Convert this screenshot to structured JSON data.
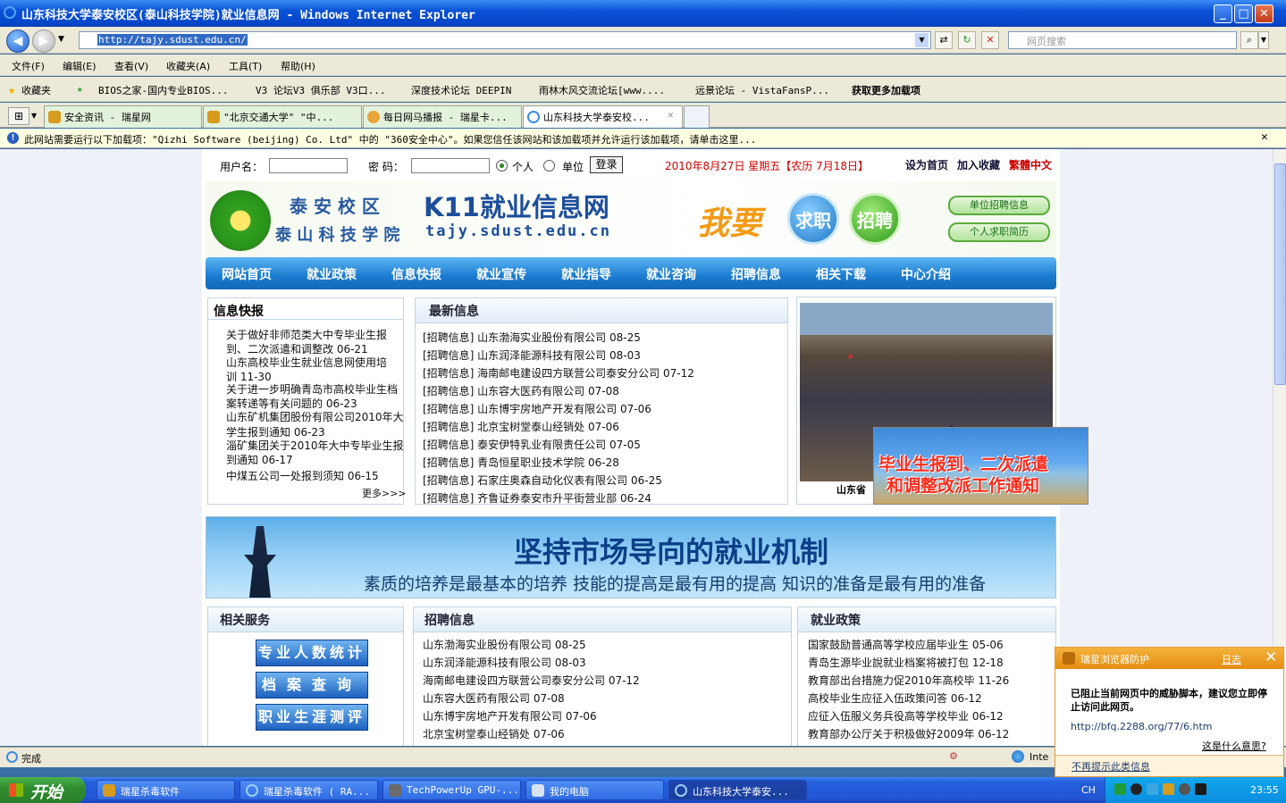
{
  "window": {
    "title": "山东科技大学泰安校区(泰山科技学院)就业信息网 - Windows Internet Explorer"
  },
  "address": {
    "url": "http://tajy.sdust.edu.cn/",
    "search_placeholder": "网页搜索"
  },
  "menu": [
    "文件(F)",
    "编辑(E)",
    "查看(V)",
    "收藏夹(A)",
    "工具(T)",
    "帮助(H)"
  ],
  "favorites": {
    "label": "收藏夹",
    "items": [
      "BIOS之家-国内专业BIOS...",
      "V3 论坛V3 俱乐部 V3口...",
      "深度技术论坛 DEEPIN",
      "雨林木风交流论坛[www....",
      "远景论坛 - VistaFansP...",
      "获取更多加载项"
    ]
  },
  "tabs": [
    "安全资讯 - 瑞星网",
    "\"北京交通大学\" \"中...",
    "每日网马播报 - 瑞星卡...",
    "山东科技大学泰安校..."
  ],
  "infobar": "此网站需要运行以下加载项：\"Qizhi Software (beijing) Co. Ltd\" 中的 \"360安全中心\"。如果您信任该网站和该加载项并允许运行该加载项，请单击这里...",
  "login": {
    "user_label": "用户名：",
    "pwd_label": "密 码：",
    "radio1": "个人",
    "radio2": "单位",
    "submit": "登录",
    "date": "2010年8月27日 星期五【农历 7月18日】",
    "set_home": "设为首页",
    "add_fav": "加入收藏",
    "trad": "繁體中文"
  },
  "banner": {
    "campus": "泰 安 校 区",
    "college": "泰 山 科 技 学 院",
    "title": "K11就业信息网",
    "domain": "tajy.sdust.edu.cn",
    "want": "我要",
    "job": "求职",
    "recruit": "招聘",
    "btn1": "单位招聘信息",
    "btn2": "个人求职简历"
  },
  "nav": [
    "网站首页",
    "就业政策",
    "信息快报",
    "就业宣传",
    "就业指导",
    "就业咨询",
    "招聘信息",
    "相关下载",
    "中心介绍"
  ],
  "news": {
    "title": "信息快报",
    "lines": [
      "关于做好非师范类大中专毕业生报",
      "到、二次派遣和调整改 06-21",
      "山东高校毕业生就业信息网使用培",
      "训 11-30",
      "关于进一步明确青岛市高校毕业生档",
      "案转递等有关问题的 06-23",
      "山东矿机集团股份有限公司2010年大",
      "学生报到通知 06-23",
      "淄矿集团关于2010年大中专毕业生报",
      "到通知 06-17",
      "中煤五公司一处报到须知 06-15"
    ],
    "more": "更多>>>"
  },
  "latest": {
    "title": "最新信息",
    "items": [
      "[招聘信息] 山东渤海实业股份有限公司  08-25",
      "[招聘信息] 山东润泽能源科技有限公司  08-03",
      "[招聘信息] 海南邮电建设四方联营公司泰安分公司  07-12",
      "[招聘信息] 山东容大医药有限公司  07-08",
      "[招聘信息] 山东博宇房地产开发有限公司  07-06",
      "[招聘信息] 北京宝树堂泰山经销处  07-06",
      "[招聘信息] 泰安伊特乳业有限责任公司  07-05",
      "[招聘信息] 青岛恒星职业技术学院  06-28",
      "[招聘信息] 石家庄奥森自动化仪表有限公司  06-25",
      "[招聘信息] 齐鲁证券泰安市升平街营业部  06-24"
    ]
  },
  "photo": {
    "caption": "山东省",
    "banner1": "毕业生报到、二次派遣",
    "banner2": "和调整改派工作通知"
  },
  "slogan": {
    "big": "坚持市场导向的就业机制",
    "small": "素质的培养是最基本的培养 技能的提高是最有用的提高 知识的准备是最有用的准备"
  },
  "services": {
    "title": "相关服务",
    "btns": [
      "专业人数统计",
      "档案查询",
      "职业生涯测评"
    ]
  },
  "recruit": {
    "title": "招聘信息",
    "items": [
      "山东渤海实业股份有限公司 08-25",
      "山东润泽能源科技有限公司 08-03",
      "海南邮电建设四方联营公司泰安分公司 07-12",
      "山东容大医药有限公司 07-08",
      "山东博宇房地产开发有限公司 07-06",
      "北京宝树堂泰山经销处 07-06"
    ]
  },
  "policy": {
    "title": "就业政策",
    "items": [
      "国家鼓励普通高等学校应届毕业生 05-06",
      "青岛生源毕业說就业档案将被打包 12-18",
      "教育部出台措施力促2010年高校毕 11-26",
      "高校毕业生应征入伍政策问答 06-12",
      "应征入伍服义务兵役高等学校毕业 06-12",
      "教育部办公厅关于积极做好2009年 06-12"
    ]
  },
  "status": {
    "text": "完成",
    "zone": "Inte"
  },
  "popup": {
    "title": "瑞星浏览器防护",
    "log": "日志",
    "msg": "已阻止当前网页中的威胁脚本，建议您立即停止访问此网页。",
    "url": "http://bfq.2288.org/77/6.htm",
    "what": "这是什么意思?",
    "dont": "不再提示此类信息"
  },
  "taskbar": {
    "start": "开始",
    "items": [
      "瑞星杀毒软件",
      "瑞星杀毒软件 ( RA...",
      "TechPowerUp GPU-...",
      "我的电脑",
      "山东科技大学泰安..."
    ],
    "lang": "CH",
    "time": "23:55"
  }
}
